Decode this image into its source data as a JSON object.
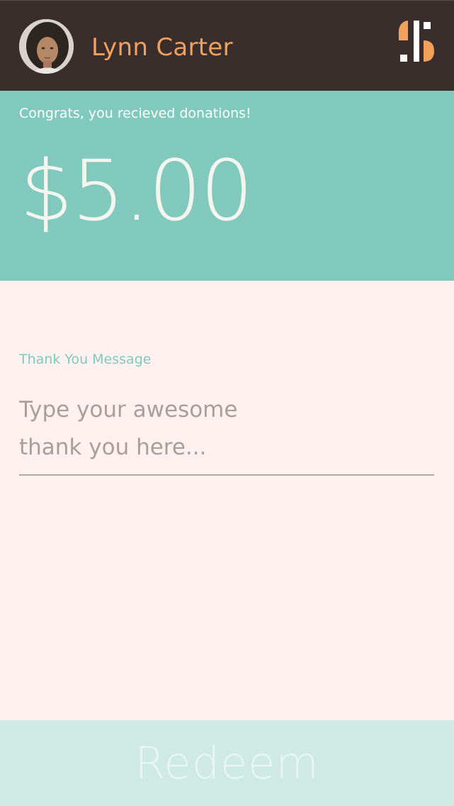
{
  "header": {
    "user_name": "Lynn Carter",
    "avatar_icon": "user-avatar",
    "logo_icon": "dollar-logo-icon"
  },
  "donation": {
    "message": "Congrats, you recieved donations!",
    "amount": "$5.00"
  },
  "thank_you": {
    "label": "Thank You Message",
    "placeholder": "Type your awesome thank you here..."
  },
  "actions": {
    "redeem_label": "Redeem"
  },
  "colors": {
    "header_bg": "#3a2e2d",
    "accent_orange": "#f2a05c",
    "accent_teal": "#80c9bc",
    "page_bg": "#fef1f0",
    "button_bg": "#cfe9e3"
  }
}
